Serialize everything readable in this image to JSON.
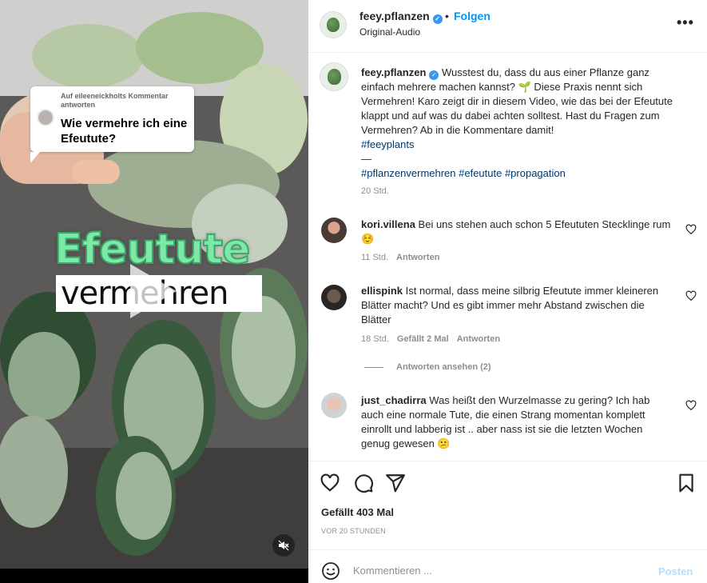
{
  "video": {
    "reply_meta": "Auf eileeneickholts Kommentar antworten",
    "reply_question": "Wie vermehre ich eine Efeutute?",
    "title_big": "Efeutute",
    "subtitle": "vermehren",
    "mute_icon": "speaker-muted-icon"
  },
  "header": {
    "username": "feey.pflanzen",
    "follow_label": "Folgen",
    "dot": "•",
    "audio": "Original-Audio",
    "more_label": "•••"
  },
  "caption": {
    "username": "feey.pflanzen",
    "text_1": "Wusstest du, dass du aus einer Pflanze ganz einfach mehrere machen kannst? 🌱 Diese Praxis nennt sich Vermehren! Karo zeigt dir in diesem Video, wie das bei der Efeutute klappt und auf was du dabei achten solltest. Hast du Fragen zum Vermehren? Ab in die Kommentare damit!",
    "hashtag_main": "#feeyplants",
    "separator": "—",
    "hashtags": "#pflanzenvermehren #efeutute #propagation",
    "time": "20 Std."
  },
  "comments": [
    {
      "username": "kori.villena",
      "text": "Bei uns stehen auch schon 5 Efeututen Stecklinge rum ☺️",
      "time": "11 Std.",
      "likes": "",
      "reply_label": "Antworten"
    },
    {
      "username": "ellispink",
      "text": "Ist normal, dass meine silbrig Efeutute immer kleineren Blätter macht? Und es gibt immer mehr Abstand zwischen die Blätter",
      "time": "18 Std.",
      "likes": "Gefällt 2 Mal",
      "reply_label": "Antworten"
    },
    {
      "username": "just_chadirra",
      "text": "Was heißt den Wurzelmasse zu gering? Ich hab auch eine normale Tute, die einen Strang momentan komplett einrollt und labberig ist .. aber nass ist sie die letzten Wochen genug gewesen 😕",
      "time": "",
      "likes": "",
      "reply_label": ""
    }
  ],
  "replies_toggle": "Antworten ansehen (2)",
  "actions": {
    "likes": "Gefällt 403 Mal",
    "posted": "VOR 20 STUNDEN"
  },
  "comment_bar": {
    "placeholder": "Kommentieren ...",
    "post_label": "Posten"
  },
  "colors": {
    "accent": "#0095f6",
    "post_disabled": "#b2dffc",
    "hashtag": "#00376b",
    "muted": "#8e8e8e"
  }
}
